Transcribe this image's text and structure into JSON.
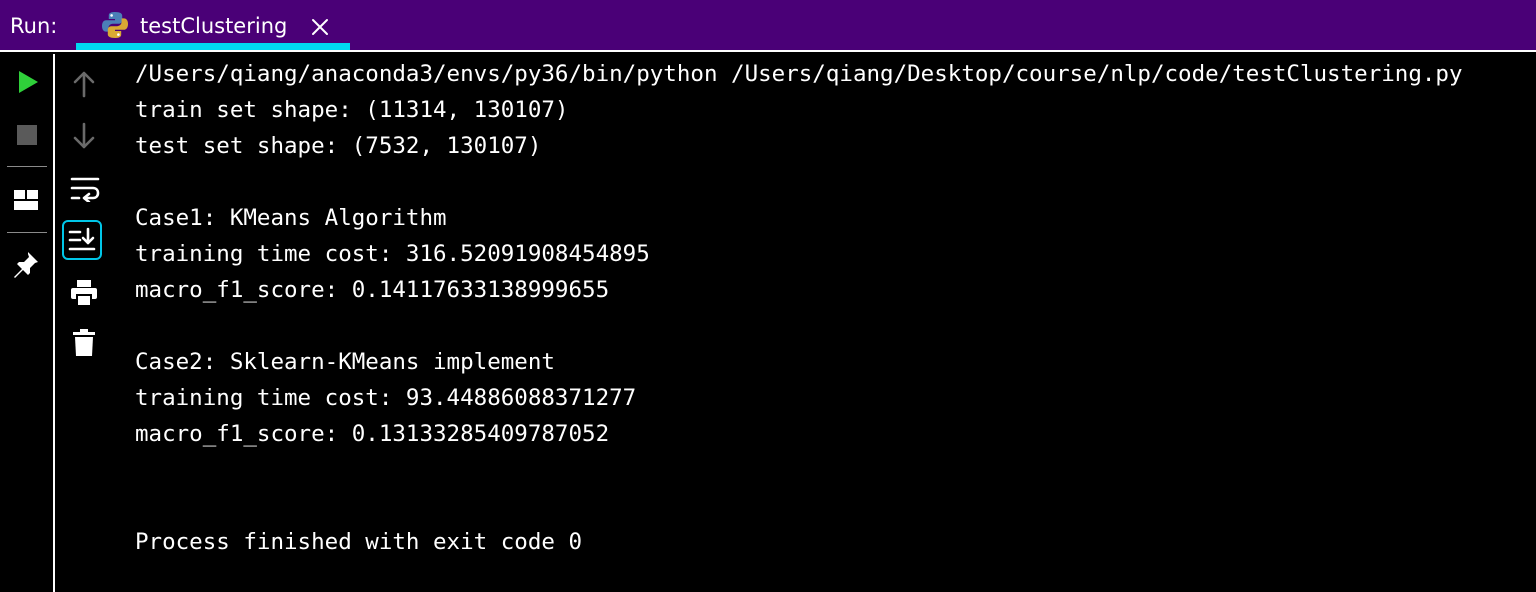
{
  "run_panel": {
    "label": "Run:",
    "tab": {
      "title": "testClustering",
      "icon": "python-icon",
      "close_icon": "close-icon"
    }
  },
  "toolbar": {
    "left": [
      "run-icon",
      "stop-icon",
      "layout-icon",
      "pin-icon"
    ],
    "right": [
      "arrow-up-icon",
      "arrow-down-icon",
      "soft-wrap-icon",
      "scroll-to-end-icon",
      "print-icon",
      "trash-icon"
    ]
  },
  "console": {
    "lines": [
      "/Users/qiang/anaconda3/envs/py36/bin/python /Users/qiang/Desktop/course/nlp/code/testClustering.py",
      "train set shape: (11314, 130107)",
      "test set shape: (7532, 130107)",
      "",
      "Case1: KMeans Algorithm",
      "training time cost: 316.52091908454895",
      "macro_f1_score: 0.14117633138999655",
      "",
      "Case2: Sklearn-KMeans implement",
      "training time cost: 93.44886088371277",
      "macro_f1_score: 0.13133285409787052",
      "",
      "",
      "Process finished with exit code 0"
    ]
  },
  "colors": {
    "header_bg": "#4a0077",
    "tab_underline": "#00d7f0",
    "run_green": "#2fd03a",
    "console_bg": "#000000",
    "console_text": "#ffffff"
  }
}
